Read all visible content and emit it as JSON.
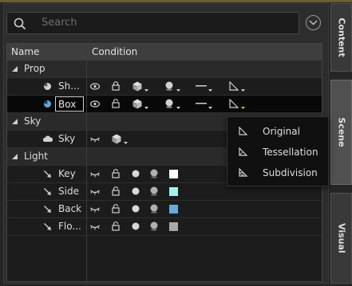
{
  "search": {
    "placeholder": "Search"
  },
  "tabs": [
    {
      "label": "Content"
    },
    {
      "label": "Scene"
    },
    {
      "label": "Visual"
    }
  ],
  "table": {
    "columns": [
      "Name",
      "Condition"
    ],
    "rows": [
      {
        "type": "group",
        "label": "Prop"
      },
      {
        "type": "item",
        "label": "Sh..."
      },
      {
        "type": "item",
        "label": "Box",
        "selected": true
      },
      {
        "type": "group",
        "label": "Sky"
      },
      {
        "type": "item",
        "label": "Sky"
      },
      {
        "type": "group",
        "label": "Light"
      },
      {
        "type": "item",
        "label": "Key",
        "color": "#ffffff"
      },
      {
        "type": "item",
        "label": "Side",
        "color": "#a8f0e8"
      },
      {
        "type": "item",
        "label": "Back",
        "color": "#6aaad8"
      },
      {
        "type": "item",
        "label": "Flo...",
        "color": "#a8a8a8"
      }
    ]
  },
  "menu": {
    "items": [
      {
        "label": "Original",
        "icon": "original-icon"
      },
      {
        "label": "Tessellation",
        "icon": "tessellation-icon"
      },
      {
        "label": "Subdivision",
        "icon": "subdivision-icon"
      }
    ]
  },
  "colors": {
    "accent": "#6c5f2c",
    "selected_row": "#090909"
  }
}
